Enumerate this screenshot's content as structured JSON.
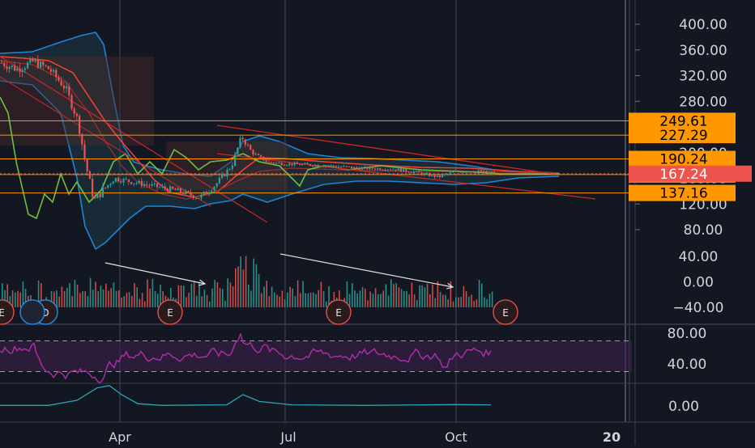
{
  "colors": {
    "background": "#131722",
    "grid": "#2a2e39",
    "axis_text": "#d1d4dc",
    "bull": "#26a69a",
    "bear": "#ef5350",
    "bb_line": "#2196f3",
    "bb_fill": "#1f4e5a",
    "ma_green": "#6fbf40",
    "ma_red": "#f44336",
    "level_line": "#ff9800",
    "last_price": "#ef5350",
    "rsi_line": "#b02fa8",
    "rsi_band": "#3c1f4a",
    "osc_line": "#2aa5b5",
    "annotation_arrow": "#e0e0e0",
    "earnings_marker": "#ef5350",
    "dividend_marker": "#2196f3"
  },
  "chart_data": [
    {
      "type": "candlestick",
      "x_ticks": [
        "Apr",
        "Jul",
        "Oct",
        "20"
      ],
      "y_ticks": [
        "400.00",
        "360.00",
        "320.00",
        "280.00",
        "240.00",
        "200.00",
        "160.00",
        "120.00",
        "80.00"
      ],
      "ylim": [
        40,
        410
      ],
      "price_levels": [
        {
          "label": "249.61",
          "value": 249.61
        },
        {
          "label": "227.29",
          "value": 227.29
        },
        {
          "label": "190.24",
          "value": 190.24
        },
        {
          "label": "165.86",
          "value": 165.86
        },
        {
          "label": "137.16",
          "value": 137.16
        }
      ],
      "last_price": {
        "label": "167.24",
        "value": 167.24
      },
      "trendlines": [
        "descending resistance",
        "descending support",
        "initial downtrend channel"
      ],
      "candles_approx": [
        {
          "date": "Feb",
          "close": 335
        },
        {
          "date": "Mar",
          "close": 290
        },
        {
          "date": "late Mar",
          "close": 120
        },
        {
          "date": "Apr",
          "close": 150
        },
        {
          "date": "May",
          "close": 140
        },
        {
          "date": "Jun",
          "close": 175
        },
        {
          "date": "mid Jun",
          "close": 230
        },
        {
          "date": "Jul",
          "close": 180
        },
        {
          "date": "Aug",
          "close": 175
        },
        {
          "date": "Sep",
          "close": 165
        },
        {
          "date": "Oct",
          "close": 170
        }
      ],
      "event_markers": [
        "E",
        "D",
        "E",
        "E",
        "E"
      ],
      "grid": true
    },
    {
      "type": "bar",
      "name": "histogram",
      "y_ticks": [
        "40.00",
        "0.00",
        "−40.00"
      ],
      "ylim": [
        -55,
        60
      ],
      "annotation_arrows": 2
    },
    {
      "type": "line",
      "name": "RSI",
      "y_ticks": [
        "80.00",
        "40.00"
      ],
      "bands": [
        30,
        70
      ],
      "ylim": [
        15,
        95
      ]
    },
    {
      "type": "line",
      "name": "oscillator",
      "y_ticks": [
        "0.00"
      ],
      "ylim": [
        -10,
        30
      ]
    }
  ]
}
